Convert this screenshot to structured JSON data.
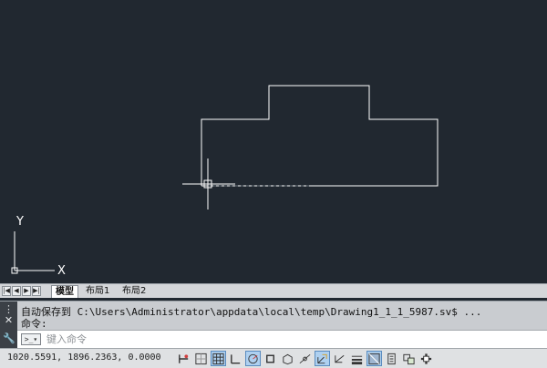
{
  "canvas": {
    "background": "#212830",
    "line_color": "#ffffff",
    "ucs_labels": {
      "x": "X",
      "y": "Y"
    }
  },
  "layout_tabs": {
    "nav_buttons": [
      "first-icon",
      "prev-icon",
      "next-icon",
      "last-icon"
    ],
    "tabs": [
      {
        "label": "模型",
        "active": true
      },
      {
        "label": "布局1",
        "active": false
      },
      {
        "label": "布局2",
        "active": false
      }
    ]
  },
  "command_window": {
    "history": [
      "自动保存到 C:\\Users\\Administrator\\appdata\\local\\temp\\Drawing1_1_1_5987.sv$ ...",
      "命令:"
    ],
    "input_placeholder": "键入命令",
    "close_icon": "close-icon",
    "customize_icon": "wrench-icon",
    "prompt_icon": "command-prompt-icon"
  },
  "status_bar": {
    "coordinates": "1020.5591, 1896.2363, 0.0000",
    "toggles": [
      {
        "name": "infer-constraints-icon",
        "on": false
      },
      {
        "name": "snap-mode-icon",
        "on": false
      },
      {
        "name": "grid-display-icon",
        "on": true
      },
      {
        "name": "ortho-mode-icon",
        "on": false
      },
      {
        "name": "polar-tracking-icon",
        "on": true
      },
      {
        "name": "object-snap-icon",
        "on": false
      },
      {
        "name": "3d-object-snap-icon",
        "on": false
      },
      {
        "name": "object-snap-tracking-icon",
        "on": false
      },
      {
        "name": "dynamic-ucs-icon",
        "on": true
      },
      {
        "name": "dynamic-input-icon",
        "on": false
      },
      {
        "name": "lineweight-icon",
        "on": false
      },
      {
        "name": "transparency-icon",
        "on": true
      },
      {
        "name": "quick-properties-icon",
        "on": false
      },
      {
        "name": "selection-cycling-icon",
        "on": false
      },
      {
        "name": "annotation-monitor-icon",
        "on": false
      }
    ]
  }
}
